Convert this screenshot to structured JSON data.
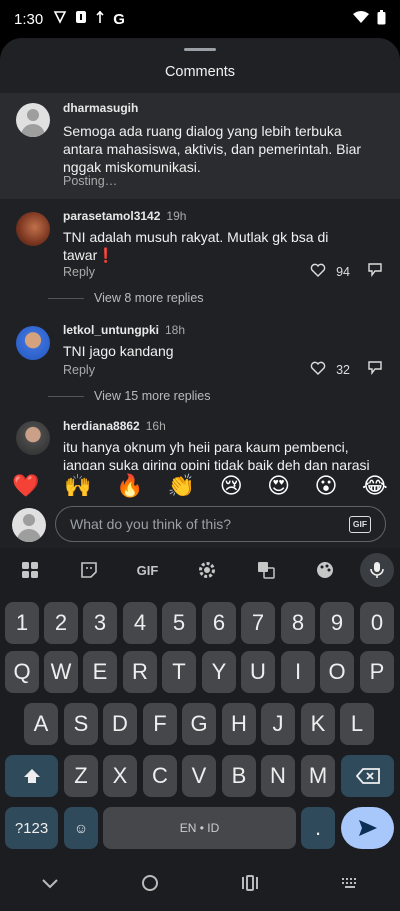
{
  "status": {
    "time": "1:30"
  },
  "sheet": {
    "title": "Comments"
  },
  "pending": {
    "username": "dharmasugih",
    "text": "Semoga ada ruang dialog yang lebih terbuka antara mahasiswa, aktivis, dan pemerintah. Biar nggak miskomunikasi.",
    "status": "Posting…"
  },
  "comments": [
    {
      "username": "parasetamol3142",
      "ago": "19h",
      "text": "TNI adalah musuh rakyat. Mutlak gk bsa di tawar❗",
      "reply": "Reply",
      "likes": "94",
      "more": "View 8 more replies"
    },
    {
      "username": "letkol_untungpki",
      "ago": "18h",
      "text": "TNI jago kandang",
      "reply": "Reply",
      "likes": "32",
      "more": "View 15 more replies"
    },
    {
      "username": "herdiana8862",
      "ago": "16h",
      "text": "itu hanya oknum yh heii para kaum pembenci, jangan suka giring opini tidak baik deh dan narasi"
    }
  ],
  "emojis": [
    "❤️",
    "🙌",
    "🔥",
    "👏",
    "😢",
    "😍",
    "😮",
    "😂"
  ],
  "input": {
    "placeholder": "What do you think of this?",
    "gif": "GIF"
  },
  "keyboard": {
    "tools_gif": "GIF",
    "row_numbers": [
      "1",
      "2",
      "3",
      "4",
      "5",
      "6",
      "7",
      "8",
      "9",
      "0"
    ],
    "row1": [
      "Q",
      "W",
      "E",
      "R",
      "T",
      "Y",
      "U",
      "I",
      "O",
      "P"
    ],
    "row2": [
      "A",
      "S",
      "D",
      "F",
      "G",
      "H",
      "J",
      "K",
      "L"
    ],
    "row3": [
      "Z",
      "X",
      "C",
      "V",
      "B",
      "N",
      "M"
    ],
    "sym": "?123",
    "space": "EN • ID",
    "period": "."
  },
  "colors": {
    "sheet": "#1f2125",
    "key": "#45474b",
    "enter": "#a8c7fa"
  }
}
